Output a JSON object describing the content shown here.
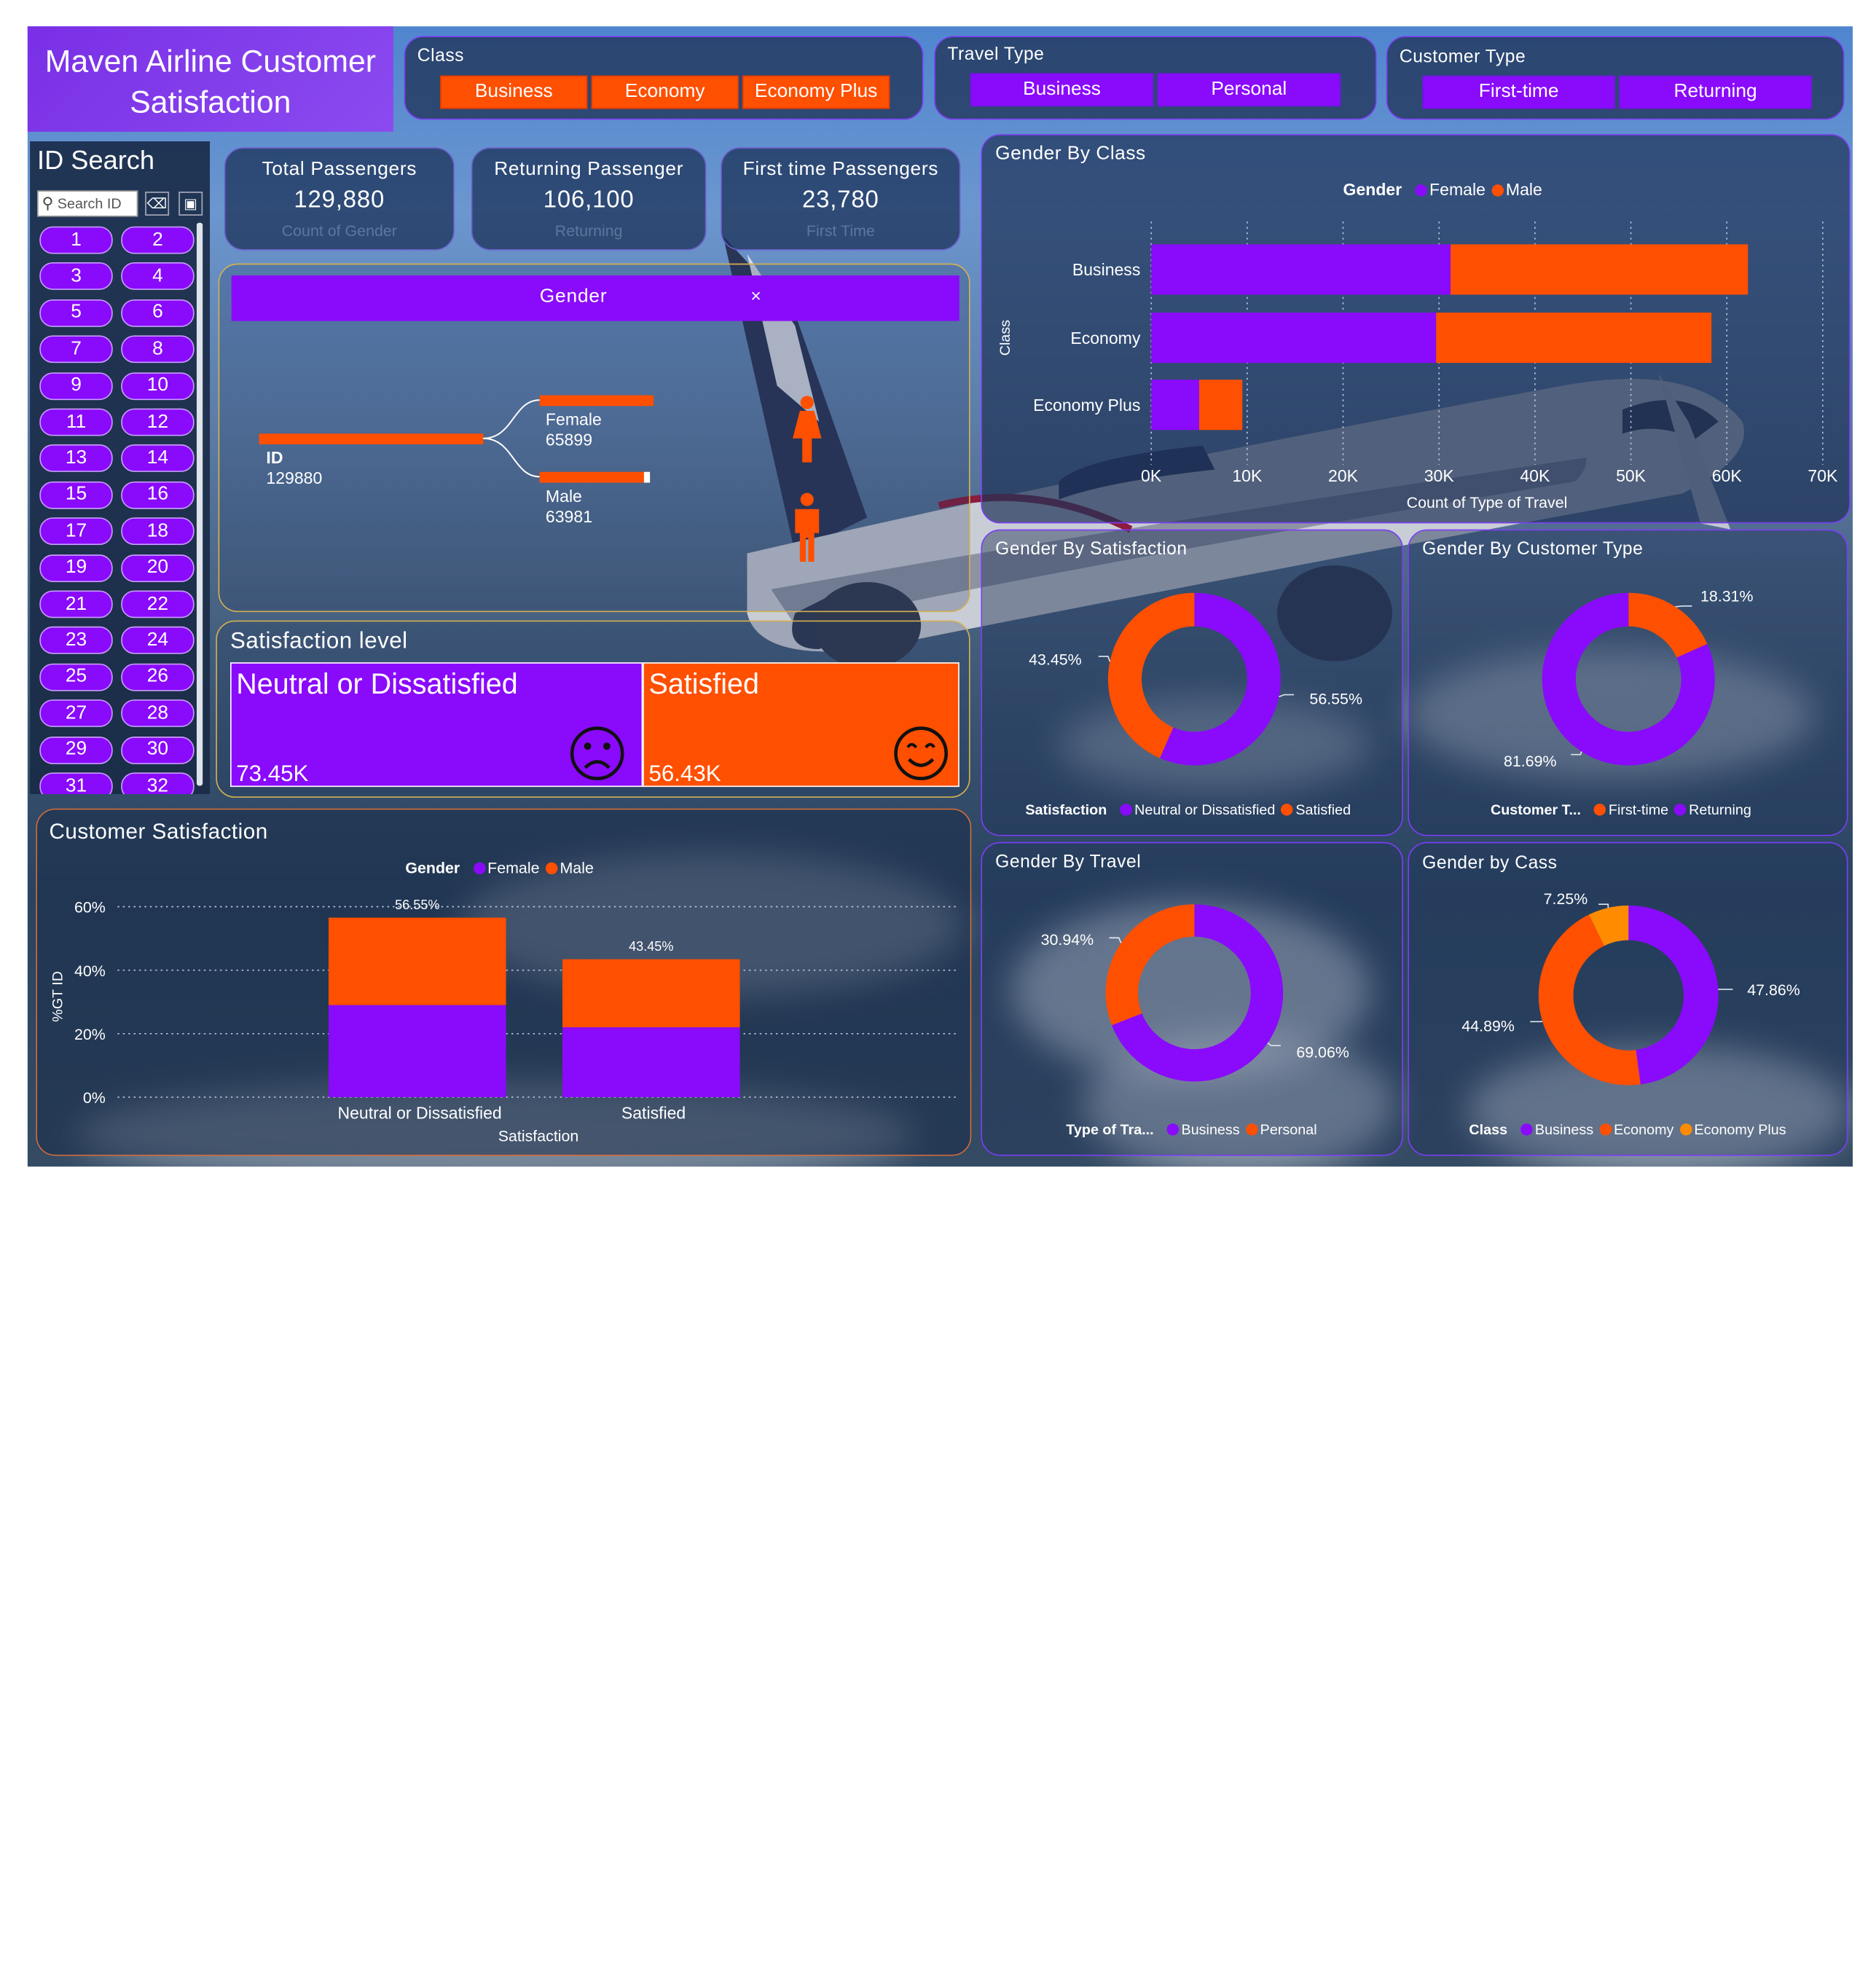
{
  "title_line1": "Maven Airline Customer",
  "title_line2": "Satisfaction",
  "colors": {
    "purple": "#8a0afc",
    "orange": "#ff4f00",
    "amber": "#ff8c00"
  },
  "slicers": {
    "class": {
      "title": "Class",
      "options": [
        "Business",
        "Economy",
        "Economy Plus"
      ]
    },
    "travel": {
      "title": "Travel Type",
      "options": [
        "Business",
        "Personal"
      ]
    },
    "customer": {
      "title": "Customer Type",
      "options": [
        "First-time",
        "Returning"
      ]
    }
  },
  "id_search": {
    "title": "ID Search",
    "placeholder": "Search ID",
    "icons": [
      "eraser-icon",
      "select-all-icon"
    ],
    "ids": [
      "1",
      "2",
      "3",
      "4",
      "5",
      "6",
      "7",
      "8",
      "9",
      "10",
      "11",
      "12",
      "13",
      "14",
      "15",
      "16",
      "17",
      "18",
      "19",
      "20",
      "21",
      "22",
      "23",
      "24",
      "25",
      "26",
      "27",
      "28",
      "29",
      "30",
      "31",
      "32"
    ]
  },
  "cards": [
    {
      "title": "Total Passengers",
      "value": "129,880",
      "subtitle": "Count of Gender"
    },
    {
      "title": "Returning Passenger",
      "value": "106,100",
      "subtitle": "Returning"
    },
    {
      "title": "First time Passengers",
      "value": "23,780",
      "subtitle": "First Time"
    }
  ],
  "gender_tree": {
    "header": "Gender",
    "close": "×",
    "root": {
      "label": "ID",
      "value": "129880",
      "count": 129880
    },
    "female": {
      "label": "Female",
      "value": "65899",
      "count": 65899
    },
    "male": {
      "label": "Male",
      "value": "63981",
      "count": 63981
    }
  },
  "satisfaction_level": {
    "title": "Satisfaction level",
    "neutral": {
      "label": "Neutral or Dissatisfied",
      "value": "73.45K",
      "amount": 73450
    },
    "satisfied": {
      "label": "Satisfied",
      "value": "56.43K",
      "amount": 56430
    }
  },
  "chart_data": [
    {
      "id": "gender_by_class",
      "type": "bar",
      "orientation": "horizontal",
      "stacked": true,
      "title": "Gender By Class",
      "legend_title": "Gender",
      "legend": [
        "Female",
        "Male"
      ],
      "categories": [
        "Business",
        "Economy",
        "Economy Plus"
      ],
      "series": [
        {
          "name": "Female",
          "values": [
            31200,
            29700,
            5000
          ]
        },
        {
          "name": "Male",
          "values": [
            31000,
            28700,
            4500
          ]
        }
      ],
      "xlabel": "Count of Type of Travel",
      "ylabel": "Class",
      "xlim": [
        0,
        70000
      ],
      "xticks": [
        "0K",
        "10K",
        "20K",
        "30K",
        "40K",
        "50K",
        "60K",
        "70K"
      ],
      "grid": true,
      "legend_position": "top-center"
    },
    {
      "id": "gender_by_satisfaction",
      "type": "pie",
      "donut": true,
      "title": "Gender By Satisfaction",
      "legend_title": "Satisfaction",
      "legend": [
        "Neutral or Dissatisfied",
        "Satisfied"
      ],
      "values": [
        56.55,
        43.45
      ],
      "labels": [
        "56.55%",
        "43.45%"
      ],
      "colors": [
        "#8a0afc",
        "#ff4f00"
      ],
      "legend_position": "bottom"
    },
    {
      "id": "gender_by_customer_type",
      "type": "pie",
      "donut": true,
      "title": "Gender By Customer Type",
      "legend_title": "Customer T...",
      "legend": [
        "First-time",
        "Returning"
      ],
      "values": [
        18.31,
        81.69
      ],
      "labels": [
        "18.31%",
        "81.69%"
      ],
      "colors": [
        "#ff4f00",
        "#8a0afc"
      ],
      "legend_position": "bottom"
    },
    {
      "id": "customer_satisfaction",
      "type": "bar",
      "stacked": true,
      "title": "Customer Satisfaction",
      "legend_title": "Gender",
      "legend": [
        "Female",
        "Male"
      ],
      "categories": [
        "Neutral or Dissatisfied",
        "Satisfied"
      ],
      "series": [
        {
          "name": "Female",
          "values": [
            29,
            22
          ]
        },
        {
          "name": "Male",
          "values": [
            27.55,
            21.45
          ]
        }
      ],
      "totals": [
        "56.55%",
        "43.45%"
      ],
      "xlabel": "Satisfaction",
      "ylabel": "%GT ID",
      "ylim": [
        0,
        60
      ],
      "yticks": [
        "0%",
        "20%",
        "40%",
        "60%"
      ],
      "grid": true,
      "legend_position": "top-center"
    },
    {
      "id": "gender_by_travel",
      "type": "pie",
      "donut": true,
      "title": "Gender By Travel",
      "legend_title": "Type of Tra...",
      "legend": [
        "Business",
        "Personal"
      ],
      "values": [
        69.06,
        30.94
      ],
      "labels": [
        "69.06%",
        "30.94%"
      ],
      "colors": [
        "#8a0afc",
        "#ff4f00"
      ],
      "legend_position": "bottom"
    },
    {
      "id": "gender_by_class_donut",
      "type": "pie",
      "donut": true,
      "title": "Gender by Cass",
      "legend_title": "Class",
      "legend": [
        "Business",
        "Economy",
        "Economy Plus"
      ],
      "values": [
        47.86,
        44.89,
        7.25
      ],
      "labels": [
        "47.86%",
        "44.89%",
        "7.25%"
      ],
      "colors": [
        "#8a0afc",
        "#ff4f00",
        "#ff8c00"
      ],
      "legend_position": "bottom"
    }
  ]
}
